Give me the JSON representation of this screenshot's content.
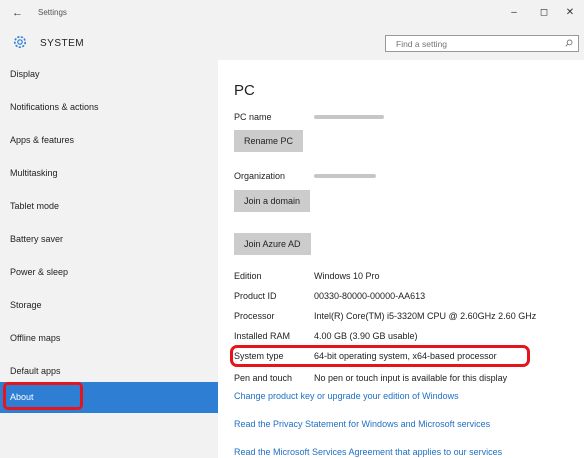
{
  "window": {
    "title": "Settings",
    "back_icon": "back-arrow-icon",
    "minimize_glyph": "–",
    "maximize_glyph": "◻",
    "close_glyph": "✕"
  },
  "header": {
    "icon": "gear-icon",
    "title": "SYSTEM",
    "search_placeholder": "Find a setting"
  },
  "sidebar": {
    "items": [
      {
        "label": "Display"
      },
      {
        "label": "Notifications & actions"
      },
      {
        "label": "Apps & features"
      },
      {
        "label": "Multitasking"
      },
      {
        "label": "Tablet mode"
      },
      {
        "label": "Battery saver"
      },
      {
        "label": "Power & sleep"
      },
      {
        "label": "Storage"
      },
      {
        "label": "Offline maps"
      },
      {
        "label": "Default apps"
      },
      {
        "label": "About",
        "active": true
      }
    ]
  },
  "main": {
    "title": "PC",
    "pc_name_label": "PC name",
    "rename_button": "Rename PC",
    "organization_label": "Organization",
    "join_domain_button": "Join a domain",
    "join_azure_button": "Join Azure AD",
    "specs": [
      {
        "label": "Edition",
        "value": "Windows 10 Pro"
      },
      {
        "label": "Product ID",
        "value": "00330-80000-00000-AA613"
      },
      {
        "label": "Processor",
        "value": "Intel(R) Core(TM) i5-3320M CPU @ 2.60GHz   2.60 GHz"
      },
      {
        "label": "Installed RAM",
        "value": "4.00 GB (3.90 GB usable)"
      },
      {
        "label": "System type",
        "value": "64-bit operating system, x64-based processor"
      },
      {
        "label": "Pen and touch",
        "value": "No pen or touch input is available for this display"
      }
    ],
    "links": [
      "Change product key or upgrade your edition of Windows",
      "Read the Privacy Statement for Windows and Microsoft services",
      "Read the Microsoft Services Agreement that applies to our services"
    ]
  },
  "colors": {
    "accent": "#2e7fd4",
    "highlight": "#e4161b",
    "link": "#1f6fc4"
  }
}
